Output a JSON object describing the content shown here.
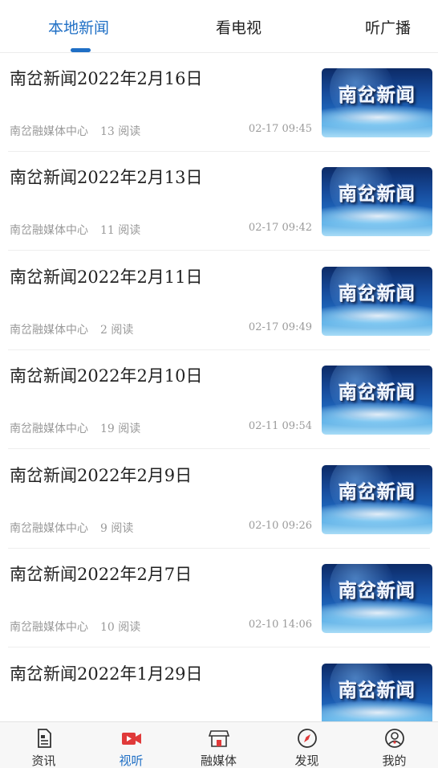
{
  "tabs": [
    {
      "label": "本地新闻",
      "active": true
    },
    {
      "label": "看电视",
      "active": false
    },
    {
      "label": "听广播",
      "active": false
    }
  ],
  "accent_color": "#1f6fc5",
  "news": [
    {
      "title": "南岔新闻2022年2月16日",
      "source": "南岔融媒体中心",
      "reads": "13 阅读",
      "time": "02-17 09:45",
      "thumb_text": "南岔新闻"
    },
    {
      "title": "南岔新闻2022年2月13日",
      "source": "南岔融媒体中心",
      "reads": "11 阅读",
      "time": "02-17 09:42",
      "thumb_text": "南岔新闻"
    },
    {
      "title": "南岔新闻2022年2月11日",
      "source": "南岔融媒体中心",
      "reads": "2 阅读",
      "time": "02-17 09:49",
      "thumb_text": "南岔新闻"
    },
    {
      "title": "南岔新闻2022年2月10日",
      "source": "南岔融媒体中心",
      "reads": "19 阅读",
      "time": "02-11 09:54",
      "thumb_text": "南岔新闻"
    },
    {
      "title": "南岔新闻2022年2月9日",
      "source": "南岔融媒体中心",
      "reads": "9 阅读",
      "time": "02-10 09:26",
      "thumb_text": "南岔新闻"
    },
    {
      "title": "南岔新闻2022年2月7日",
      "source": "南岔融媒体中心",
      "reads": "10 阅读",
      "time": "02-10 14:06",
      "thumb_text": "南岔新闻"
    },
    {
      "title": "南岔新闻2022年1月29日",
      "source": "",
      "reads": "",
      "time": "",
      "thumb_text": "南岔新闻"
    }
  ],
  "bottom_nav": [
    {
      "label": "资讯",
      "icon": "document-icon",
      "active": false
    },
    {
      "label": "视听",
      "icon": "video-camera-icon",
      "active": true
    },
    {
      "label": "融媒体",
      "icon": "storefront-icon",
      "active": false
    },
    {
      "label": "发现",
      "icon": "compass-icon",
      "active": false
    },
    {
      "label": "我的",
      "icon": "user-circle-icon",
      "active": false
    }
  ]
}
